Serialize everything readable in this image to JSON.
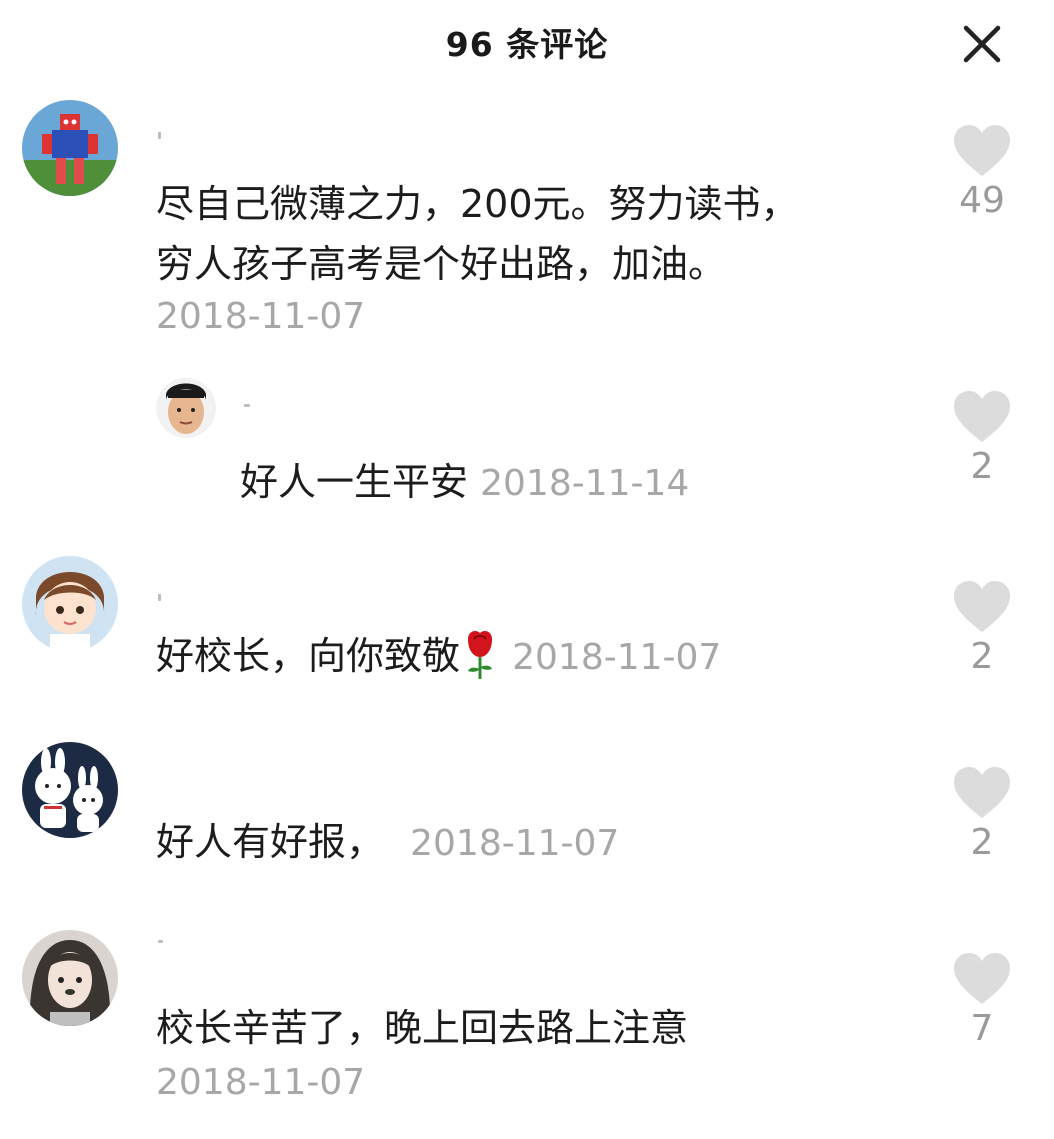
{
  "header": {
    "title": "96 条评论",
    "close_icon": "close-icon"
  },
  "colors": {
    "text": "#1c1c1c",
    "muted": "#a7a7a7",
    "heart": "#dcdcdc"
  },
  "comments": [
    {
      "lines": [
        "尽自己微薄之力，200元。努力读书，",
        "穷人孩子高考是个好出路，加油。"
      ],
      "date": "2018-11-07",
      "likes": "49",
      "avatar_icon": "robot-toy-avatar"
    },
    {
      "text": "好人一生平安",
      "date": "2018-11-14",
      "likes": "2",
      "avatar_icon": "man-face-avatar"
    },
    {
      "text": "好校长，向你致敬",
      "emoji": "rose-icon",
      "date": "2018-11-07",
      "likes": "2",
      "avatar_icon": "cartoon-girl-avatar"
    },
    {
      "text": "好人有好报，",
      "date": "2018-11-07",
      "likes": "2",
      "avatar_icon": "bunny-couple-avatar"
    },
    {
      "text": "校长辛苦了，晚上回去路上注意",
      "date": "2018-11-07",
      "likes": "7",
      "avatar_icon": "girl-photo-avatar"
    }
  ]
}
